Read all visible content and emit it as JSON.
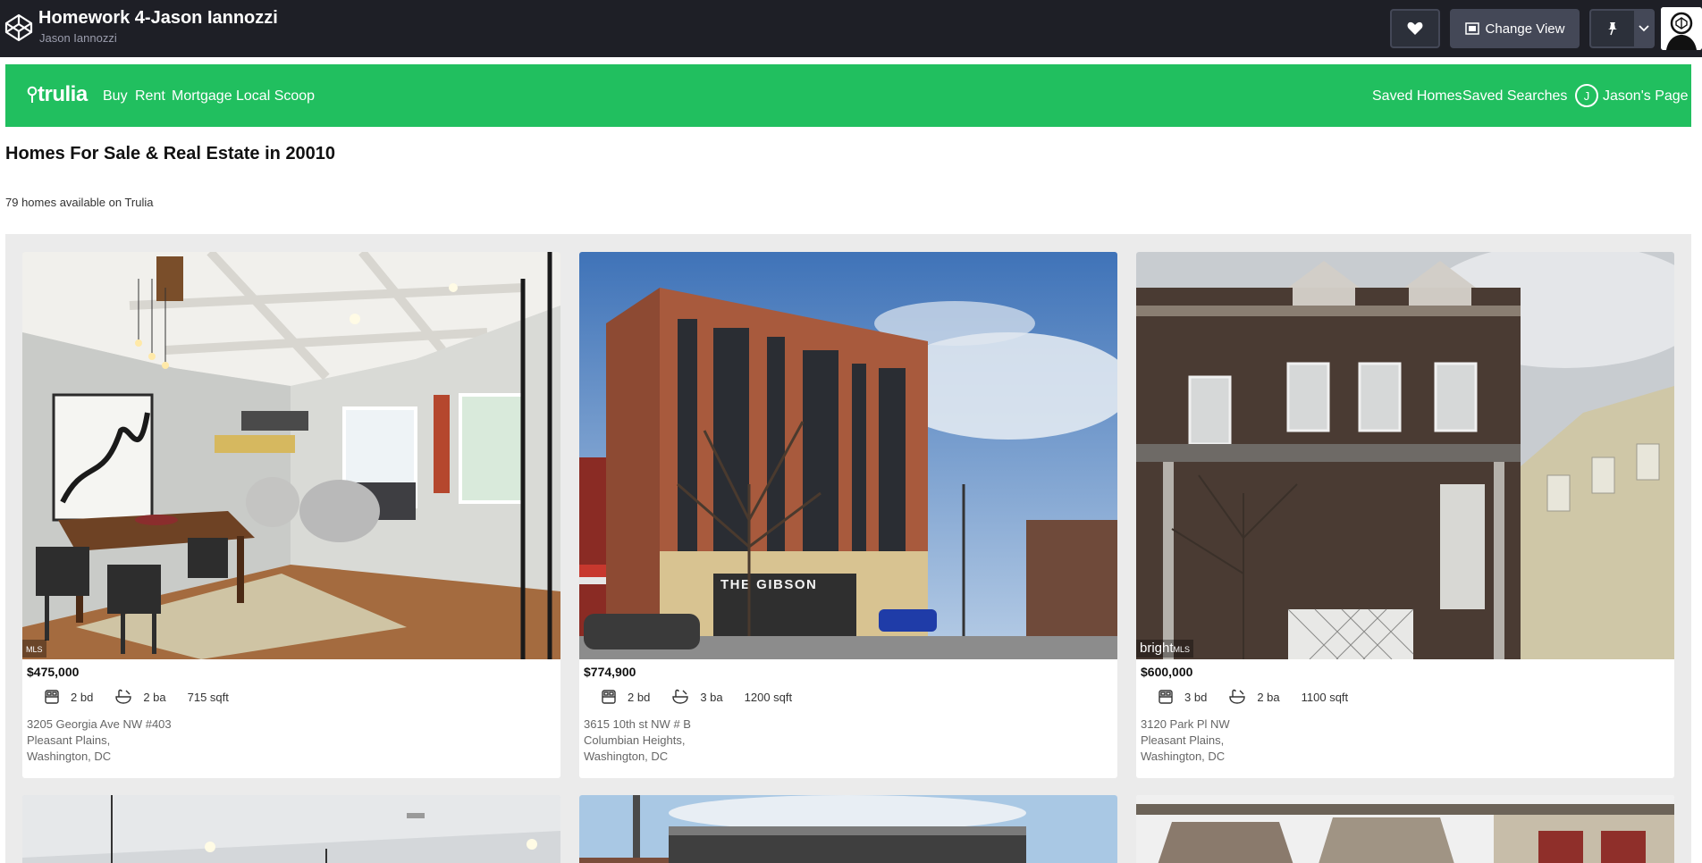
{
  "codepen": {
    "title": "Homework 4-Jason Iannozzi",
    "author": "Jason Iannozzi",
    "change_view_label": "Change View",
    "icons": {
      "logo": "codepen-logo-icon",
      "heart": "heart-icon",
      "change_view": "change-view-icon",
      "pin": "pin-icon",
      "chevron": "chevron-down-icon",
      "avatar": "user-avatar"
    }
  },
  "trulia": {
    "logo_text": "trulia",
    "brand_color": "#21bf5f",
    "nav_left": [
      "Buy",
      "Rent",
      "Mortgage",
      "Local Scoop"
    ],
    "nav_right": [
      "Saved Homes",
      "Saved Searches"
    ],
    "user_initial": "J",
    "user_page_label": "Jason's Page"
  },
  "page": {
    "title": "Homes For Sale & Real Estate in 20010",
    "subtitle": "79 homes available on Trulia"
  },
  "listings": [
    {
      "price": "$475,000",
      "beds": "2 bd",
      "baths": "2 ba",
      "sqft": "715 sqft",
      "street": "3205 Georgia Ave NW #403",
      "neighborhood": "Pleasant Plains,",
      "city": "Washington, DC",
      "badge_main": "",
      "badge_small": "MLS"
    },
    {
      "price": "$774,900",
      "beds": "2 bd",
      "baths": "3 ba",
      "sqft": "1200 sqft",
      "street": "3615 10th st NW # B",
      "neighborhood": "Columbian Heights,",
      "city": "Washington, DC",
      "building_sign": "THE GIBSON"
    },
    {
      "price": "$600,000",
      "beds": "3 bd",
      "baths": "2 ba",
      "sqft": "1100 sqft",
      "street": "3120 Park Pl NW",
      "neighborhood": "Pleasant Plains,",
      "city": "Washington, DC",
      "badge_main": "bright",
      "badge_small": "MLS"
    }
  ]
}
